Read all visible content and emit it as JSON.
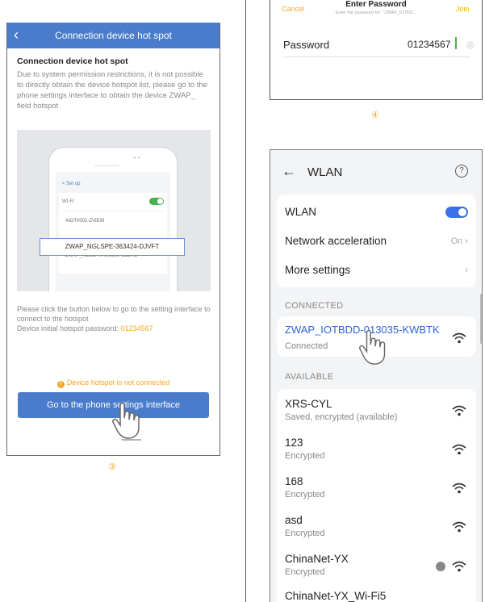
{
  "left_screen": {
    "header_title": "Connection device hot spot",
    "back_glyph": "‹",
    "heading": "Connection device hot spot",
    "description": "Due to system permission restrictions, it is not possible to directly obtain the device hotspot list, please go to the phone settings interface to obtain the device ZWAP_ field hotspot",
    "illustration": {
      "setup_label": "< Set up",
      "wifi_label": "WI-FI",
      "network_1": "AIOT0001-ZVIEW",
      "highlight_network": "ZWAP_NGLSPE-363424-DJVFT",
      "network_3": "ZWAP_NGLSPN-091989-CLDVD"
    },
    "instruction_line": "Please click the button below to go to the setting interface to connect to the hotspot",
    "password_prefix": "Device initial hotspot password: ",
    "password_value": "01234567",
    "status_warning": "Device hotspot is not connected",
    "button_label": "Go to the phone settings interface",
    "step_marker": "③"
  },
  "password_dialog": {
    "cancel_label": "Cancel",
    "title": "Enter Password",
    "subtitle": "Enter the password for \" ZWAP_IOTBD...",
    "join_label": "Join",
    "field_label": "Password",
    "field_value": "01234567",
    "step_marker": "④"
  },
  "wlan_screen": {
    "back_glyph": "←",
    "title": "WLAN",
    "help_glyph": "?",
    "settings": {
      "wlan_label": "WLAN",
      "accel_label": "Network acceleration",
      "accel_value": "On",
      "more_label": "More settings"
    },
    "connected_header": "CONNECTED",
    "connected_network": {
      "name": "ZWAP_IOTBDD-013035-KWBTK",
      "status": "Connected"
    },
    "available_header": "AVAILABLE",
    "available_networks": [
      {
        "name": "XRS-CYL",
        "status": "Saved, encrypted (available)"
      },
      {
        "name": "123",
        "status": "Encrypted"
      },
      {
        "name": "168",
        "status": "Encrypted"
      },
      {
        "name": "asd",
        "status": "Encrypted"
      },
      {
        "name": "ChinaNet-YX",
        "status": "Encrypted"
      },
      {
        "name": "ChinaNet-YX_Wi-Fi5",
        "status": ""
      }
    ],
    "chevron_glyph": "›"
  },
  "colors": {
    "header_blue": "#4a7ccb",
    "accent_orange": "#f5a623",
    "connected_blue": "#2f63d8",
    "toggle_green": "#4caf50"
  }
}
